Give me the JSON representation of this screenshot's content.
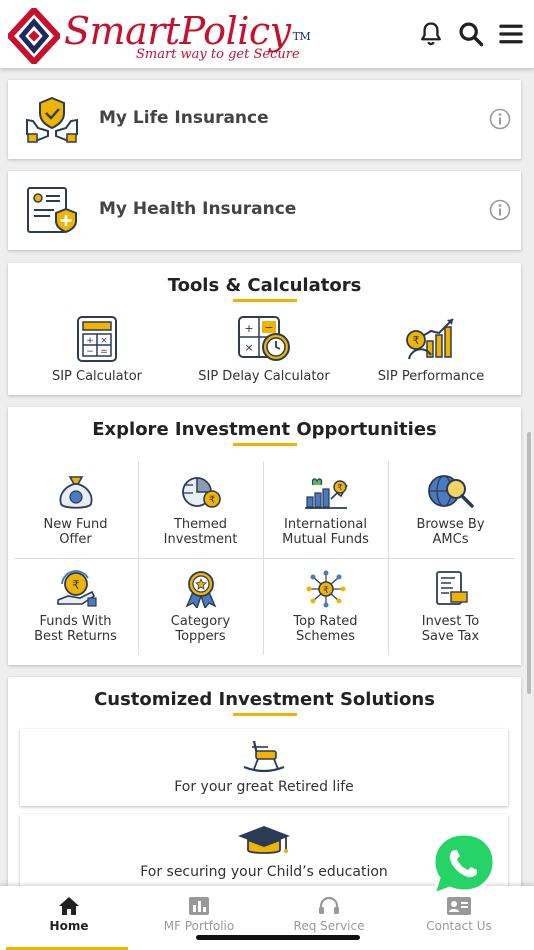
{
  "header": {
    "brand": "SmartPolicy",
    "trademark": "TM",
    "tagline": "Smart way to get Secure"
  },
  "insurance": [
    {
      "label": "My Life Insurance"
    },
    {
      "label": "My Health Insurance"
    }
  ],
  "tools": {
    "title": "Tools & Calculators",
    "items": [
      {
        "label": "SIP Calculator"
      },
      {
        "label": "SIP Delay Calculator"
      },
      {
        "label": "SIP Performance"
      }
    ]
  },
  "explore": {
    "title": "Explore Investment Opportunities",
    "items": [
      {
        "line1": "New Fund",
        "line2": "Offer"
      },
      {
        "line1": "Themed",
        "line2": "Investment"
      },
      {
        "line1": "International",
        "line2": "Mutual Funds"
      },
      {
        "line1": "Browse By",
        "line2": "AMCs"
      },
      {
        "line1": "Funds With",
        "line2": "Best Returns"
      },
      {
        "line1": "Category",
        "line2": "Toppers"
      },
      {
        "line1": "Top Rated",
        "line2": "Schemes"
      },
      {
        "line1": "Invest To",
        "line2": "Save Tax"
      }
    ]
  },
  "solutions": {
    "title": "Customized Investment Solutions",
    "items": [
      {
        "label": "For your great Retired life"
      },
      {
        "label": "For securing your Child’s education"
      }
    ]
  },
  "nav": {
    "items": [
      {
        "label": "Home"
      },
      {
        "label": "MF Portfolio"
      },
      {
        "label": "Req Service"
      },
      {
        "label": "Contact Us"
      }
    ]
  },
  "colors": {
    "brand_red": "#c8102e",
    "brand_blue": "#1a2a5c",
    "accent": "#f0b400",
    "whatsapp": "#25d366"
  },
  "icons": {
    "header": [
      "bell-icon",
      "search-icon",
      "hamburger-menu-icon"
    ],
    "floating": "whatsapp-icon"
  }
}
